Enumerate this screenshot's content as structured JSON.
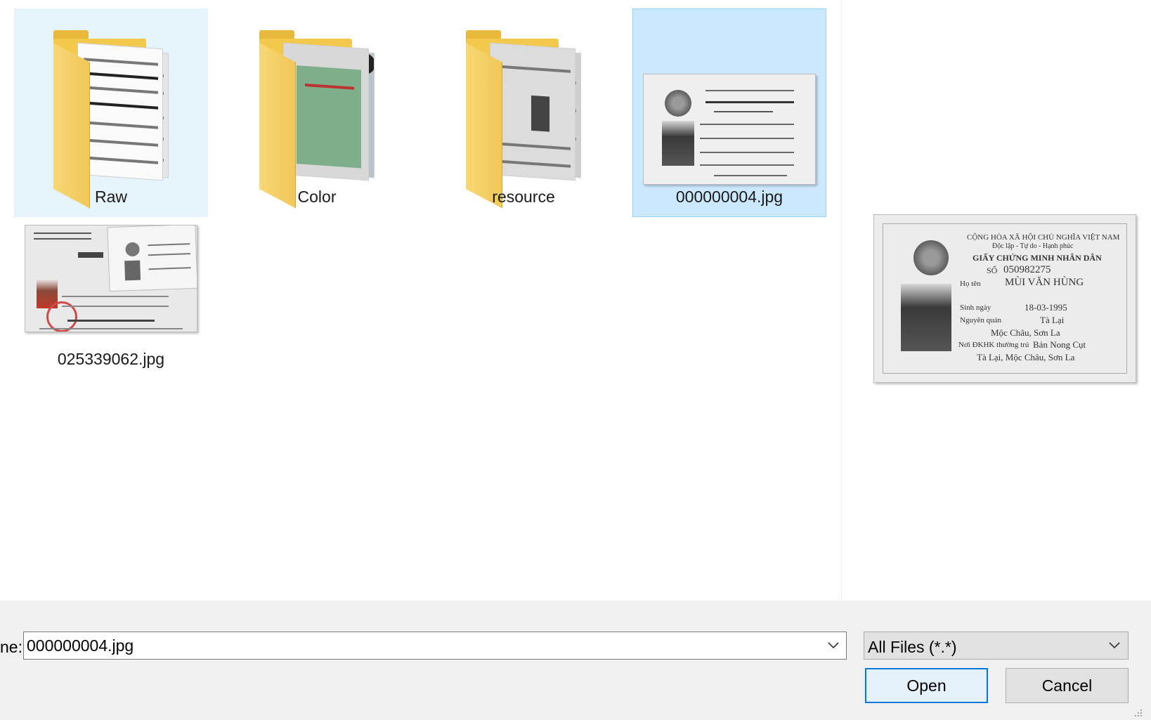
{
  "files": {
    "items": [
      {
        "name": "Raw",
        "type": "folder",
        "state": "hover"
      },
      {
        "name": "Color",
        "type": "folder",
        "state": "normal"
      },
      {
        "name": "resource",
        "type": "folder",
        "state": "normal"
      },
      {
        "name": "000000004.jpg",
        "type": "image",
        "state": "selected"
      },
      {
        "name": "025339062.jpg",
        "type": "image",
        "state": "normal"
      }
    ]
  },
  "preview": {
    "header": "CỘNG HÒA XÃ HỘI CHỦ NGHĨA VIỆT NAM",
    "motto": "Độc lập - Tự do - Hạnh phúc",
    "title": "GIẤY CHỨNG MINH NHÂN DÂN",
    "number_label": "SỐ",
    "number": "050982275",
    "name_label": "Họ tên",
    "name": "MÙI VĂN HÙNG",
    "dob_label": "Sinh ngày",
    "dob": "18-03-1995",
    "origin_label": "Nguyên quán",
    "origin_1": "Tà Lại",
    "origin_2": "Mộc Châu, Sơn La",
    "residence_label": "Nơi ĐKHK thường trú",
    "residence_1": "Bản Nong Cụt",
    "residence_2": "Tà Lại, Mộc Châu, Sơn La"
  },
  "footer": {
    "filename_label": "ne:",
    "filename_value": "000000004.jpg",
    "filter_value": "All Files (*.*)",
    "open_label": "Open",
    "cancel_label": "Cancel"
  },
  "colors": {
    "selected_bg": "#cce8ff",
    "selected_border": "#99d1ff",
    "hover_bg": "#e5f3fb",
    "folder_yellow": "#f2c94c",
    "primary_border": "#0078d7",
    "bar_bg": "#f0f0f0"
  },
  "icons": [
    "folder-icon",
    "chevron-down-icon",
    "resize-grip-icon"
  ]
}
